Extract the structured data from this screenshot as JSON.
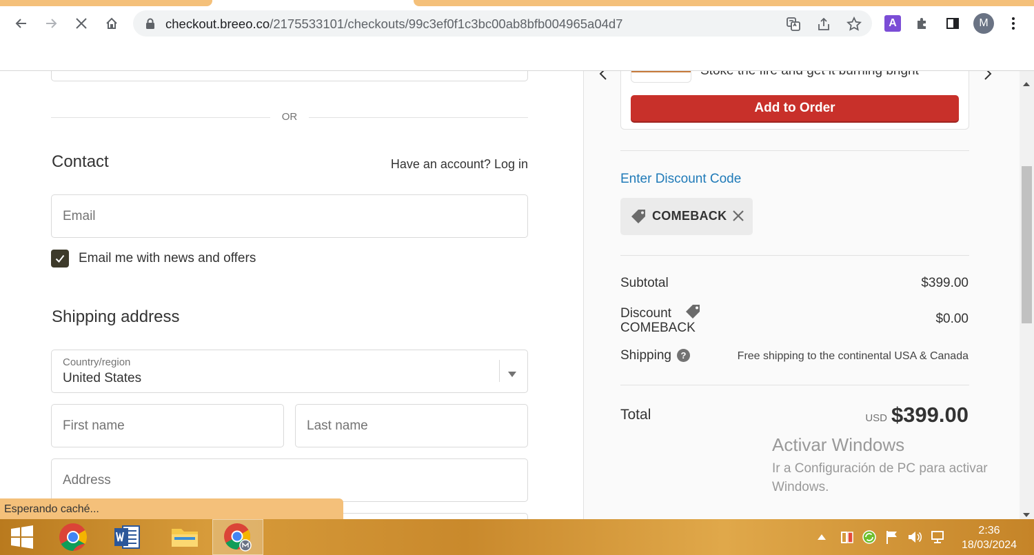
{
  "browser": {
    "url_host": "checkout.breeo.co",
    "url_path": "/2175533101/checkouts/99c3ef0f1c3bc00ab8bfb004965a04d7",
    "profile_initial": "M",
    "extension_letter": "A",
    "status_text": "Esperando caché..."
  },
  "checkout": {
    "or_text": "OR",
    "contact_heading": "Contact",
    "have_account_text": "Have an account?",
    "login_link": "Log in",
    "email_placeholder": "Email",
    "newsletter_label": "Email me with news and offers",
    "newsletter_checked": true,
    "shipping_heading": "Shipping address",
    "country_label": "Country/region",
    "country_value": "United States",
    "first_name_placeholder": "First name",
    "last_name_placeholder": "Last name",
    "address_placeholder": "Address"
  },
  "summary": {
    "upsell_description": "Stoke the fire and get it burning bright",
    "add_to_order_label": "Add to Order",
    "discount_link": "Enter Discount Code",
    "discount_code": "COMEBACK",
    "subtotal_label": "Subtotal",
    "subtotal_value": "$399.00",
    "discount_label": "Discount",
    "discount_code_line": "COMEBACK",
    "discount_value": "$0.00",
    "shipping_label": "Shipping",
    "shipping_value": "Free shipping to the continental USA & Canada",
    "total_label": "Total",
    "total_currency": "USD",
    "total_value": "$399.00"
  },
  "watermark": {
    "title": "Activar Windows",
    "subtitle": "Ir a Configuración de PC para activar Windows."
  },
  "taskbar": {
    "time": "2:36",
    "date": "18/03/2024"
  },
  "colors": {
    "accent_button": "#c8302a",
    "link": "#1f7ab8",
    "checkbox": "#3d3a2a",
    "taskbar": "#d79b3a",
    "status_bubble": "#f4c07a"
  }
}
